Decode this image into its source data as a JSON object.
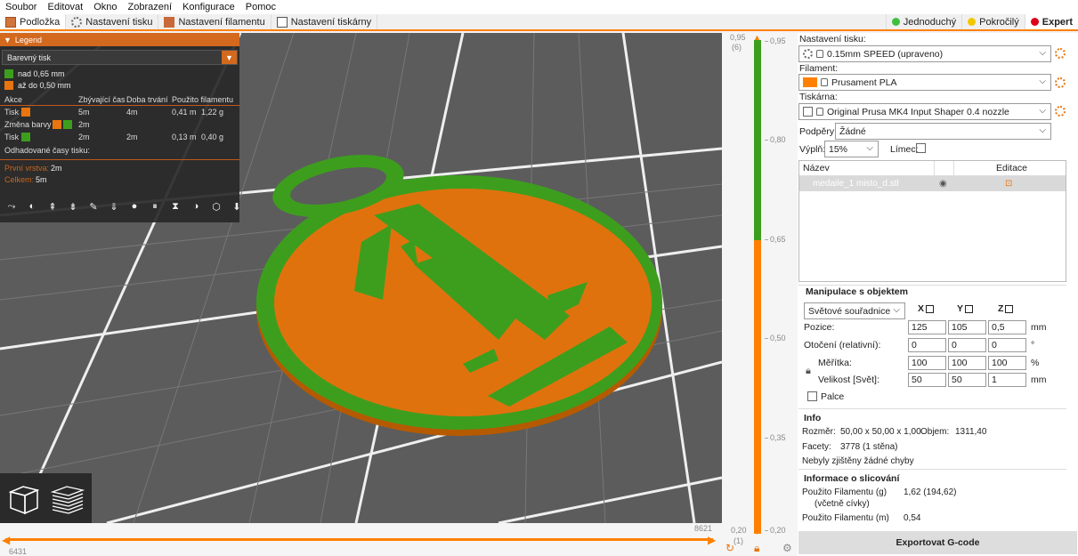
{
  "menu": [
    "Soubor",
    "Editovat",
    "Okno",
    "Zobrazení",
    "Konfigurace",
    "Pomoc"
  ],
  "tabs": [
    {
      "label": "Podložka",
      "icon": "plate-icon",
      "active": true
    },
    {
      "label": "Nastavení tisku",
      "icon": "gear-icon",
      "active": false
    },
    {
      "label": "Nastavení filamentu",
      "icon": "spool-icon",
      "active": false
    },
    {
      "label": "Nastavení tiskárny",
      "icon": "printer-icon",
      "active": false
    }
  ],
  "modes": [
    {
      "label": "Jednoduchý",
      "color": "#3fbf3f"
    },
    {
      "label": "Pokročilý",
      "color": "#f0c800"
    },
    {
      "label": "Expert",
      "color": "#e0001a"
    }
  ],
  "legend": {
    "title": "Legend",
    "view_type": "Barevný tisk",
    "items": [
      {
        "label": "nad 0,65 mm",
        "color": "#3d9e1e"
      },
      {
        "label": "až do 0,50 mm",
        "color": "#e87510"
      }
    ],
    "table_headers": [
      "Akce",
      "Zbývající čas",
      "Doba trvání",
      "Použito filamentu"
    ],
    "table_rows": [
      {
        "action": "Tisk",
        "swatches": [
          "#e87510"
        ],
        "remaining": "5m",
        "duration": "4m",
        "used_m": "0,41 m",
        "used_g": "1,22 g"
      },
      {
        "action": "Změna barvy",
        "swatches": [
          "#e87510",
          "#3d9e1e"
        ],
        "remaining": "2m",
        "duration": "",
        "used_m": "",
        "used_g": ""
      },
      {
        "action": "Tisk",
        "swatches": [
          "#3d9e1e"
        ],
        "remaining": "2m",
        "duration": "2m",
        "used_m": "0,13 m",
        "used_g": "0,40 g"
      }
    ],
    "estimate_title": "Odhadované časy tisku:",
    "first_layer_label": "První vrstva:",
    "first_layer_value": "2m",
    "total_label": "Celkem:",
    "total_value": "5m"
  },
  "hslider": {
    "left_value": "6431",
    "right_value": "8621"
  },
  "vslider": {
    "top_label": "0,95",
    "top_index": "(6)",
    "bottom_label": "0,20",
    "bottom_index": "(1)",
    "ticks": [
      "0,95",
      "0,80",
      "0,65",
      "0,50",
      "0,35",
      "0,20"
    ]
  },
  "right": {
    "print_settings_label": "Nastavení tisku:",
    "print_settings_value": "0.15mm SPEED (upraveno)",
    "filament_label": "Filament:",
    "filament_value": "Prusament PLA",
    "filament_color": "#ff8000",
    "printer_label": "Tiskárna:",
    "printer_value": "Original Prusa MK4 Input Shaper 0.4 nozzle",
    "supports_label": "Podpěry:",
    "supports_value": "Žádné",
    "infill_label": "Výplň:",
    "infill_value": "15%",
    "brim_label": "Límec:",
    "list_header_name": "Název",
    "list_header_edit": "Editace",
    "object_name": "medaile_1 misto_d.stl",
    "manip_title": "Manipulace s objektem",
    "coords_value": "Světové souřadnice",
    "axes": [
      "X",
      "Y",
      "Z"
    ],
    "position_label": "Pozice:",
    "position": [
      "125",
      "105",
      "0,5"
    ],
    "position_unit": "mm",
    "rotation_label": "Otočení (relativní):",
    "rotation": [
      "0",
      "0",
      "0"
    ],
    "rotation_unit": "°",
    "scale_label": "Měřítka:",
    "scale": [
      "100",
      "100",
      "100"
    ],
    "scale_unit": "%",
    "size_label": "Velikost [Svět]:",
    "size": [
      "50",
      "50",
      "1"
    ],
    "size_unit": "mm",
    "inches_label": "Palce",
    "info_title": "Info",
    "dims_label": "Rozměr:",
    "dims_value": "50,00 x 50,00 x 1,00",
    "volume_label": "Objem:",
    "volume_value": "1311,40",
    "facets_label": "Facety:",
    "facets_value": "3778 (1 stěna)",
    "errors_text": "Nebyly zjištěny žádné chyby",
    "slice_info_title": "Informace o slicování",
    "filament_g_label": "Použito Filamentu (g)",
    "filament_g_sub": "(včetně cívky)",
    "filament_g_value": "1,62 (194,62)",
    "filament_m_label": "Použito Filamentu (m)",
    "filament_m_value": "0,54",
    "export_label": "Exportovat G-code"
  },
  "colors": {
    "accent": "#ff8000",
    "green": "#3d9e1e",
    "orange": "#e87510",
    "bed": "#5a5a5a"
  }
}
